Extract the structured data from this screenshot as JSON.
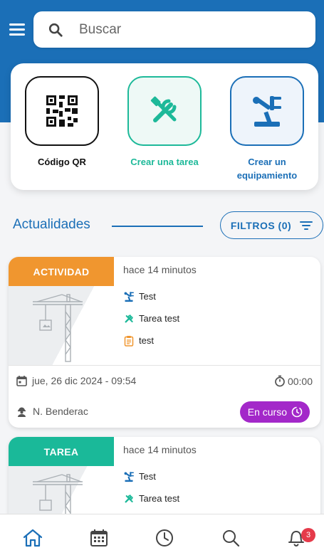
{
  "search": {
    "placeholder": "Buscar"
  },
  "quick_actions": [
    {
      "label": "Código QR",
      "icon": "qr-code-icon"
    },
    {
      "label": "Crear una tarea",
      "icon": "tools-icon",
      "color": "#1db999"
    },
    {
      "label": "Crear un equipamiento",
      "icon": "equipment-icon",
      "color": "#1b6fb7"
    }
  ],
  "feed": {
    "title": "Actualidades",
    "filters_label": "FILTROS (0)"
  },
  "cards": [
    {
      "badge": "ACTIVIDAD",
      "badge_color": "#f0962f",
      "time": "hace 14 minutos",
      "equipment": "Test",
      "task": "Tarea test",
      "note": "test",
      "date": "jue, 26 dic 2024 - 09:54",
      "duration": "00:00",
      "person": "N. Benderac",
      "status": "En curso",
      "status_color": "#a328c9"
    },
    {
      "badge": "TAREA",
      "badge_color": "#1ab999",
      "time": "hace 14 minutos",
      "equipment": "Test",
      "task": "Tarea test"
    }
  ],
  "nav": {
    "items": [
      "home-icon",
      "calendar-icon",
      "history-icon",
      "search-icon",
      "notifications-icon"
    ],
    "notification_count": "3"
  },
  "colors": {
    "primary": "#1b6fb7",
    "accent_green": "#1db999",
    "accent_orange": "#f0962f",
    "status_purple": "#a328c9"
  }
}
